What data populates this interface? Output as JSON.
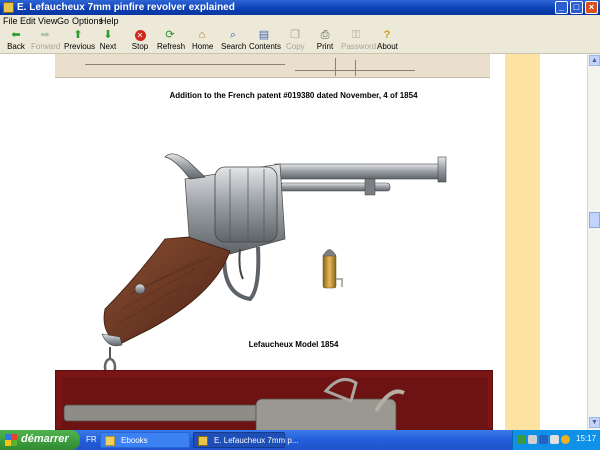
{
  "window": {
    "title": "E. Lefaucheux 7mm pinfire revolver explained"
  },
  "menu": [
    "File",
    "Edit",
    "View",
    "Go",
    "Options",
    "Help"
  ],
  "toolbar": [
    {
      "label": "Back",
      "icon": "back-arrow-icon",
      "enabled": true
    },
    {
      "label": "Forward",
      "icon": "forward-arrow-icon",
      "enabled": false
    },
    {
      "label": "Previous",
      "icon": "up-arrow-icon",
      "enabled": true
    },
    {
      "label": "Next",
      "icon": "down-arrow-icon",
      "enabled": true
    },
    {
      "label": "Stop",
      "icon": "stop-icon",
      "enabled": true
    },
    {
      "label": "Refresh",
      "icon": "refresh-icon",
      "enabled": true
    },
    {
      "label": "Home",
      "icon": "home-icon",
      "enabled": true
    },
    {
      "label": "Search",
      "icon": "search-icon",
      "enabled": true
    },
    {
      "label": "Contents",
      "icon": "contents-icon",
      "enabled": true
    },
    {
      "label": "Copy",
      "icon": "copy-icon",
      "enabled": false
    },
    {
      "label": "Print",
      "icon": "print-icon",
      "enabled": true
    },
    {
      "label": "Password",
      "icon": "password-icon",
      "enabled": false
    },
    {
      "label": "About",
      "icon": "about-icon",
      "enabled": true
    }
  ],
  "content": {
    "caption_patent": "Addition to the French patent  #019380 dated November, 4 of 1854",
    "caption_model": "Lefaucheux Model 1854"
  },
  "taskbar": {
    "start_label": "démarrer",
    "language": "FR",
    "tasks": [
      {
        "label": "Ebooks",
        "active": false
      },
      {
        "label": "E. Lefaucheux 7mm p...",
        "active": true
      }
    ],
    "clock": "15:17"
  },
  "colors": {
    "page_side_rail": "#fde2a1",
    "photo_frame": "#7a1515",
    "titlebar": "#0b3fb3"
  }
}
